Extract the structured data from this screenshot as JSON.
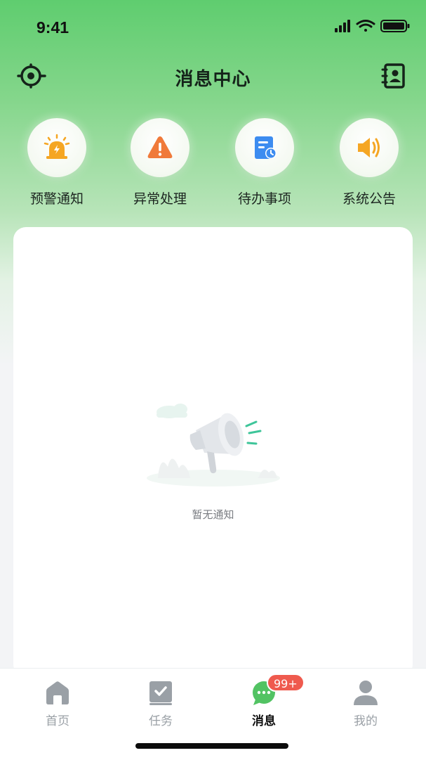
{
  "status_bar": {
    "time": "9:41"
  },
  "header": {
    "title": "消息中心",
    "left_icon": "scan-eye-icon",
    "right_icon": "contacts-book-icon"
  },
  "quick_actions": [
    {
      "label": "预警通知",
      "icon": "alarm-light-icon",
      "color": "#f5a623"
    },
    {
      "label": "异常处理",
      "icon": "warning-triangle-icon",
      "color": "#f07a3a"
    },
    {
      "label": "待办事项",
      "icon": "todo-clock-icon",
      "color": "#3d8cf0"
    },
    {
      "label": "系统公告",
      "icon": "speaker-icon",
      "color": "#f5a623"
    }
  ],
  "empty_state": {
    "text": "暂无通知",
    "icon": "megaphone-illustration"
  },
  "tab_bar": {
    "tabs": [
      {
        "label": "首页",
        "icon": "home-icon",
        "active": false
      },
      {
        "label": "任务",
        "icon": "task-check-icon",
        "active": false
      },
      {
        "label": "消息",
        "icon": "chat-bubble-icon",
        "active": true
      },
      {
        "label": "我的",
        "icon": "user-icon",
        "active": false
      }
    ],
    "badge": "99+"
  },
  "colors": {
    "brand_green": "#5fcd6f",
    "badge_red": "#ef5a4e",
    "inactive_gray": "#9aa0a6"
  }
}
